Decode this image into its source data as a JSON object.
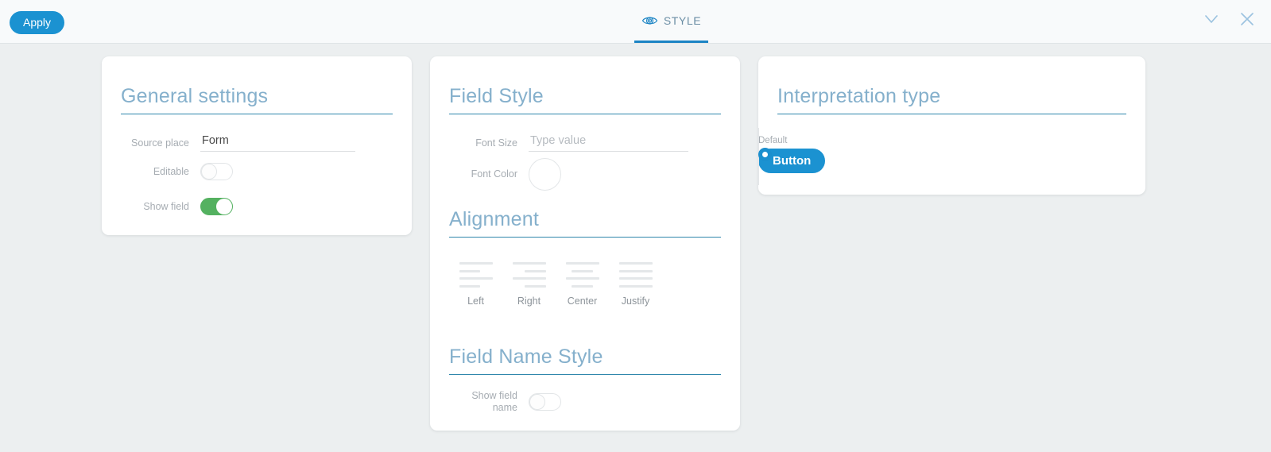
{
  "header": {
    "apply_label": "Apply",
    "tab": {
      "label": "STYLE",
      "icon": "eye-icon"
    },
    "window_controls": [
      {
        "name": "chevron-down-icon"
      },
      {
        "name": "close-icon"
      }
    ],
    "accent_color": "#1b92d1"
  },
  "general_settings": {
    "title": "General settings",
    "source_place": {
      "label": "Source place",
      "value": "Form"
    },
    "editable": {
      "label": "Editable",
      "state": "off"
    },
    "show_field": {
      "label": "Show field",
      "state": "on",
      "on_color": "#54b160"
    }
  },
  "field_style": {
    "title": "Field Style",
    "font_size": {
      "label": "Font Size",
      "placeholder": "Type value",
      "value": ""
    },
    "font_color": {
      "label": "Font Color",
      "swatch_color": "#ffffff"
    },
    "alignment": {
      "title": "Alignment",
      "options": [
        {
          "label": "Left",
          "icon": "align-left-icon"
        },
        {
          "label": "Right",
          "icon": "align-right-icon"
        },
        {
          "label": "Center",
          "icon": "align-center-icon"
        },
        {
          "label": "Justify",
          "icon": "align-justify-icon"
        }
      ]
    },
    "field_name_style": {
      "title": "Field Name Style",
      "show_field_name": {
        "label_line1": "Show field",
        "label_line2": "name",
        "state": "off"
      }
    }
  },
  "interpretation_type": {
    "title": "Interpretation type",
    "default_label": "Default",
    "button_label": "Button",
    "radio": {
      "name": "interpretation-radio",
      "selected": true,
      "color": "#1b8fce"
    }
  }
}
